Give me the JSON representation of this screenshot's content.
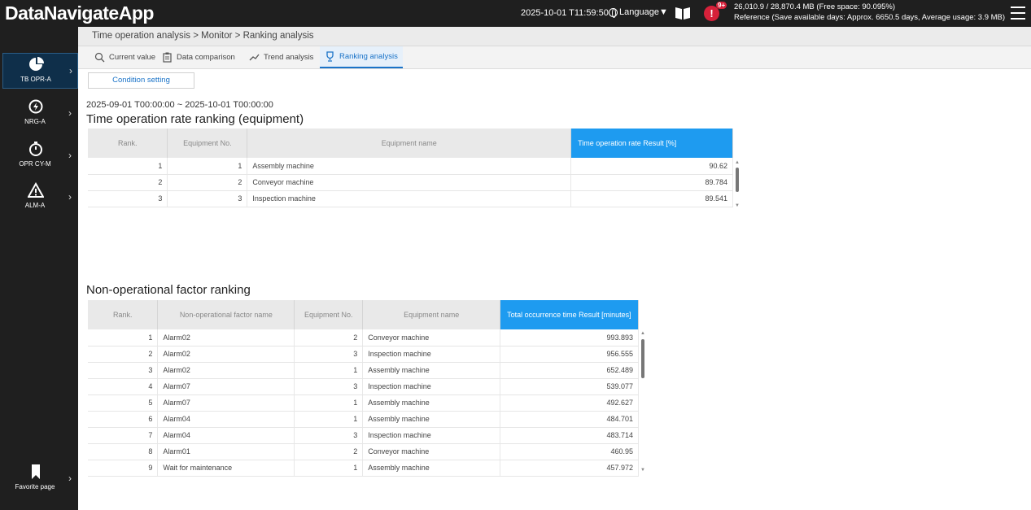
{
  "app": {
    "title": "DataNavigateApp"
  },
  "header": {
    "datetime": "2025-10-01 T11:59:50",
    "language": "Language▼",
    "alert_count": "9+",
    "storage_line1": "26,010.9 / 28,870.4 MB (Free space: 90.095%)",
    "storage_line2": "Reference (Save available days: Approx. 6650.5 days, Average usage: 3.9 MB)"
  },
  "sidebar": {
    "items": [
      {
        "label": "TB OPR-A",
        "icon": "pie-chart-icon"
      },
      {
        "label": "NRG-A",
        "icon": "energy-icon"
      },
      {
        "label": "OPR CY-M",
        "icon": "stopwatch-icon"
      },
      {
        "label": "ALM-A",
        "icon": "warning-icon"
      }
    ],
    "favorite": "Favorite page"
  },
  "breadcrumb": "Time operation analysis > Monitor > Ranking analysis",
  "tabs": [
    {
      "label": "Current value",
      "icon": "search-chart-icon"
    },
    {
      "label": "Data comparison",
      "icon": "clipboard-icon"
    },
    {
      "label": "Trend analysis",
      "icon": "trend-icon"
    },
    {
      "label": "Ranking analysis",
      "icon": "trophy-icon",
      "active": true
    }
  ],
  "condition_button": "Condition setting",
  "date_range": "2025-09-01 T00:00:00 ~ 2025-10-01 T00:00:00",
  "equipment_ranking": {
    "title": "Time operation rate ranking (equipment)",
    "headers": [
      "Rank.",
      "Equipment No.",
      "Equipment name",
      "Time operation rate  Result [%]"
    ],
    "rows": [
      [
        "1",
        "1",
        "Assembly machine",
        "90.62"
      ],
      [
        "2",
        "2",
        "Conveyor machine",
        "89.784"
      ],
      [
        "3",
        "3",
        "Inspection machine",
        "89.541"
      ]
    ]
  },
  "factor_ranking": {
    "title": "Non-operational factor ranking",
    "headers": [
      "Rank.",
      "Non-operational factor name",
      "Equipment No.",
      "Equipment name",
      "Total occurrence time  Result [minutes]"
    ],
    "rows": [
      [
        "1",
        "Alarm02",
        "2",
        "Conveyor machine",
        "993.893"
      ],
      [
        "2",
        "Alarm02",
        "3",
        "Inspection machine",
        "956.555"
      ],
      [
        "3",
        "Alarm02",
        "1",
        "Assembly machine",
        "652.489"
      ],
      [
        "4",
        "Alarm07",
        "3",
        "Inspection machine",
        "539.077"
      ],
      [
        "5",
        "Alarm07",
        "1",
        "Assembly machine",
        "492.627"
      ],
      [
        "6",
        "Alarm04",
        "1",
        "Assembly machine",
        "484.701"
      ],
      [
        "7",
        "Alarm04",
        "3",
        "Inspection machine",
        "483.714"
      ],
      [
        "8",
        "Alarm01",
        "2",
        "Conveyor machine",
        "460.95"
      ],
      [
        "9",
        "Wait for maintenance",
        "1",
        "Assembly machine",
        "457.972"
      ]
    ]
  },
  "colors": {
    "accent": "#1e9bf0",
    "alert": "#d6213a",
    "sidebar": "#1f1f1f"
  }
}
